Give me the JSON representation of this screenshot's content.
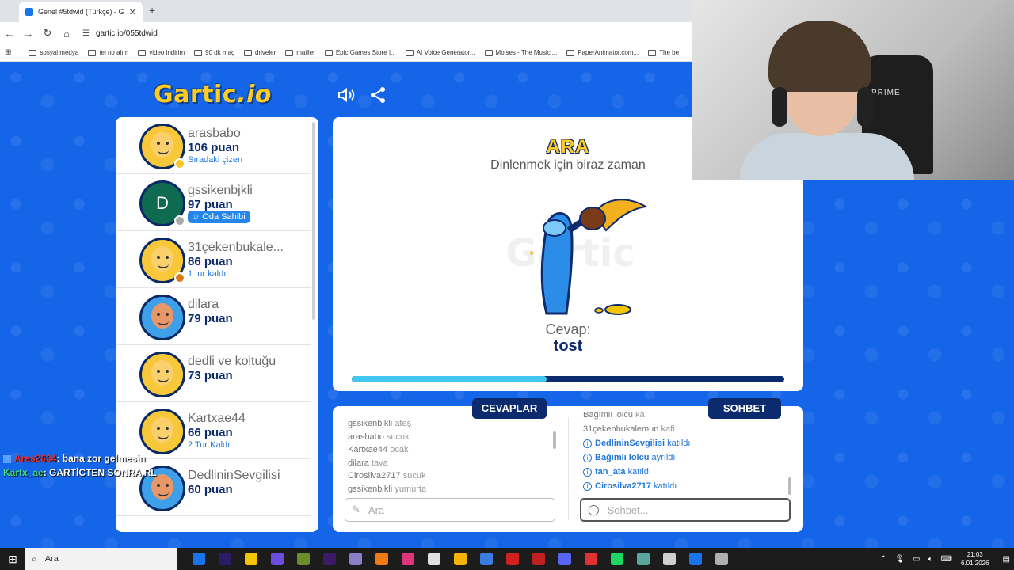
{
  "browser": {
    "tab_title": "Genel #5tdwid (Türkçe) - G",
    "tab_close": "✕",
    "new_tab": "+",
    "url": "gartic.io/055tdwid",
    "bookmarks": [
      "sosyal medya",
      "tel no alım",
      "video indirim",
      "90 dk maç",
      "driveler",
      "mailler",
      "Epic Games Store |...",
      "AI Voice Generator...",
      "Moises - The Musici...",
      "PaperAnimator.com...",
      "The be"
    ]
  },
  "game": {
    "logo_main": "Gartic",
    "logo_io": ".io",
    "players": [
      {
        "name": "arasbabo",
        "score": "106 puan",
        "note": "Sıradaki çizen",
        "avatar": "yellow",
        "dot": "#f7c52a"
      },
      {
        "name": "gssikenbjkli",
        "score": "97 puan",
        "note": "",
        "avatar": "green",
        "initial": "D",
        "dot": "#aaaaaa"
      },
      {
        "name": "31çekenbukale...",
        "score": "86 puan",
        "note": "1 tur kaldı",
        "avatar": "yellow",
        "dot": "#d9781e"
      },
      {
        "name": "dilara",
        "score": "79 puan",
        "note": "",
        "avatar": "skin",
        "dot": ""
      },
      {
        "name": "dedli ve koltuğu",
        "score": "73 puan",
        "note": "",
        "avatar": "yellow",
        "dot": ""
      },
      {
        "name": "Kartxae44",
        "score": "66 puan",
        "note": "2 Tur Kaldı",
        "avatar": "yellow",
        "dot": ""
      },
      {
        "name": "DedlininSevgilisi",
        "score": "60 puan",
        "note": "",
        "avatar": "skin",
        "dot": ""
      }
    ],
    "owner_badge": "Oda Sahibi",
    "round": {
      "title": "ARA",
      "subtitle": "Dinlenmek için biraz zaman",
      "answer_label": "Cevap:",
      "answer": "tost",
      "progress": 0.45
    },
    "answers_tab": "CEVAPLAR",
    "chat_tab": "SOHBET",
    "guesses": [
      {
        "name": "gssikenbjkli",
        "word": "ateş"
      },
      {
        "name": "arasbabo",
        "word": "sucuk"
      },
      {
        "name": "Kartxae44",
        "word": "ocak"
      },
      {
        "name": "dilara",
        "word": "tava"
      },
      {
        "name": "Cirosilva2717",
        "word": "sucuk"
      },
      {
        "name": "gssikenbjkli",
        "word": "yumurta"
      }
    ],
    "chat": [
      {
        "name": "Bağımlı lolcu",
        "msg": "ka",
        "type": "msg"
      },
      {
        "name": "31çekenbukalemun",
        "msg": "kafi",
        "type": "msg"
      },
      {
        "name": "DedlininSevgilisi",
        "msg": "katıldı",
        "type": "join"
      },
      {
        "name": "Bağımlı lolcu",
        "msg": "ayrıldı",
        "type": "join"
      },
      {
        "name": "tan_ata",
        "msg": "katıldı",
        "type": "join"
      },
      {
        "name": "Cirosilva2717",
        "msg": "katıldı",
        "type": "join"
      }
    ],
    "guess_placeholder": "Ara",
    "chat_placeholder": "Sohbet..."
  },
  "overlay": [
    {
      "user": "Aras2634",
      "msg": ": bana zor gelmesin"
    },
    {
      "user": "Kartx_ae",
      "msg": ": GARTİCTEN SONRA RL"
    }
  ],
  "webcam": {
    "chair_brand": "PRIME"
  },
  "taskbar": {
    "search": "Ara",
    "time": "21:03",
    "date": "6.01.2026",
    "app_colors": [
      "#1a73e8",
      "#2b1a66",
      "#f5c400",
      "#6b4de0",
      "#6a8f2a",
      "#3b1a66",
      "#8a7fc8",
      "#f07a14",
      "#e0347a",
      "#e0e0e0",
      "#f5b400",
      "#3a7be0",
      "#d02020",
      "#c02020",
      "#5865f2",
      "#e03030",
      "#1ed760",
      "#58a8a0",
      "#d0d0d0",
      "#1a73e8",
      "#b0b0b0"
    ]
  }
}
